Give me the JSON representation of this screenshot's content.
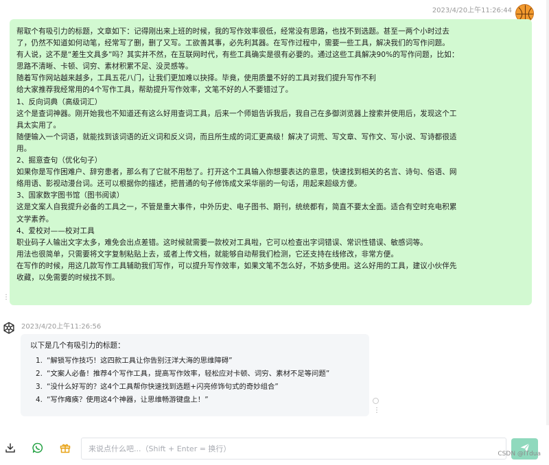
{
  "user_message": {
    "timestamp": "2023/4/20上午11:26:44",
    "lines": [
      "帮取个有吸引力的标题，文章如下：记得刚出来上班的时候，我的写作效率很低，经常没有思路，也找不到选题。甚至一两个小时过去",
      "了，仍然不知道如何动笔，经常写了删，删了又写。工欲善其事，必先利其器。在写作过程中，需要一些工具，解决我们的写作问题。",
      "有人说，这不是“差生文具多”吗？其实并不然，在互联网时代，有些工具确实是很有必要的。通过这些工具解决90%的写作问题，比如：",
      "思路不清晰、卡顿、词穷、素材积累不足、没灵感等。",
      "随着写作网站越来越多，工具五花八门，让我们更加难以抉择。毕竟，使用质量不好的工具对我们提升写作不利",
      "给大家推荐我经常用的4个写作工具，帮助提升写作效率，文笔不好的人不要错过了。",
      "1、反向词典（高级词汇）",
      "这个是查词神器。刚开始我也不知道还有这么好用查词工具，后来一个师姐告诉我后，我自己在多御浏览器上搜索并使用后，发现这个工",
      "具太实用了。",
      "随便输入一个词语，就能找到该词语的近义词和反义词，而且所生成的词汇更高级！解决了词荒、写文章、写作文、写小说、写诗都很适",
      "用。",
      "2、掘意查句（优化句子）",
      "如果你是写作困难户、辞穷患者，那么有了它就不用愁了。打开这个工具输入你想要表达的意思，快速找到相关的名言、诗句、俗语、网",
      "络用语、影视动漫台词。还可以根据你的描述，把普通的句子修饰成文采华丽的一句话，用起来超级方便。",
      "3、国家数字图书馆（图书阅读）",
      "这是文案人自我提升必备的工具之一，不管是重大事件，中外历史、电子图书、期刊，统统都有，简直不要太全面。适合有空时充电积累",
      "文学素养。",
      "4、爱校对——校对工具",
      "职业码子人输出文字太多，难免会出点差错。这时候就需要一款校对工具啦，它可以检查出字词错误、常识性错误、敏感词等。",
      "用法也很简单，只需要将文字复制粘贴上去，或者上传文档，就能够自动帮我们检测，它还支持在线修改，非常方便。",
      "在写作的时候，用这几款写作工具辅助我们写作，可以提升写作效率，如果文笔不怎么好，不妨多使用。这么好用的工具，建议小伙伴先",
      "收藏，以免需要的时候找不到。"
    ]
  },
  "bot_message": {
    "timestamp": "2023/4/20上午11:26:56",
    "intro": "以下是几个有吸引力的标题：",
    "items": [
      {
        "num": "1.",
        "text": "“解锁写作技巧！这四款工具让你告别汪洋大海的思维障碍”"
      },
      {
        "num": "2.",
        "text": "“文案人必备！推荐4个写作工具，提高写作效率，轻松应对卡顿、词穷、素材不足等问题”"
      },
      {
        "num": "3.",
        "text": "“没什么好写的？这4个工具帮你快速找到选题+闪亮修饰句式的奇妙组合”"
      },
      {
        "num": "4.",
        "text": "“写作瘫痪？使用这4个神器，让思维畅游键盘上！”"
      }
    ]
  },
  "input": {
    "placeholder": "来说点什么吧...（Shift + Enter = 换行）",
    "value": ""
  },
  "icons": {
    "download": "download-icon",
    "whatsapp": "whatsapp-icon",
    "gift": "gift-icon",
    "send": "send-icon",
    "user_avatar": "basketball-avatar",
    "bot_avatar": "openai-logo"
  },
  "colors": {
    "user_bubble": "#d2f9d1",
    "bot_bubble": "#f4f6f8",
    "send_button": "#8fd9bd",
    "whatsapp_green": "#25a244",
    "gift_orange": "#e8a317"
  },
  "watermark": "CSDN @ITdua"
}
